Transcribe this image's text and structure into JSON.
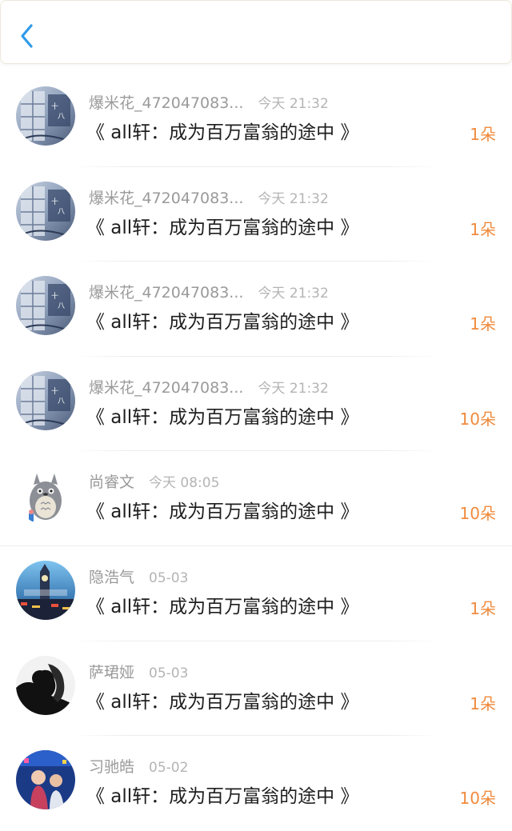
{
  "header": {
    "back_icon": "chevron-left-icon",
    "accent_color": "#2f9be8"
  },
  "colors": {
    "count": "#f08a3c",
    "name": "#9a9a9a",
    "time": "#b4b4b4",
    "title": "#1e1e1e"
  },
  "items": [
    {
      "name": "爆米花_472047083...",
      "time": "今天 21:32",
      "title": "《 all轩：成为百万富翁的途中 》",
      "count": "1朵",
      "avatar": "window-sketch-avatar"
    },
    {
      "name": "爆米花_472047083...",
      "time": "今天 21:32",
      "title": "《 all轩：成为百万富翁的途中 》",
      "count": "1朵",
      "avatar": "window-sketch-avatar"
    },
    {
      "name": "爆米花_472047083...",
      "time": "今天 21:32",
      "title": "《 all轩：成为百万富翁的途中 》",
      "count": "1朵",
      "avatar": "window-sketch-avatar"
    },
    {
      "name": "爆米花_472047083...",
      "time": "今天 21:32",
      "title": "《 all轩：成为百万富翁的途中 》",
      "count": "10朵",
      "avatar": "window-sketch-avatar"
    },
    {
      "name": "尚睿文",
      "time": "今天 08:05",
      "title": "《 all轩：成为百万富翁的途中 》",
      "count": "10朵",
      "avatar": "totoro-avatar"
    },
    {
      "name": "隐浩气",
      "time": "05-03",
      "title": "《 all轩：成为百万富翁的途中 》",
      "count": "1朵",
      "avatar": "big-ben-avatar"
    },
    {
      "name": "萨珺娅",
      "time": "05-03",
      "title": "《 all轩：成为百万富翁的途中 》",
      "count": "1朵",
      "avatar": "silhouette-avatar"
    },
    {
      "name": "习驰皓",
      "time": "05-02",
      "title": "《 all轩：成为百万富翁的途中 》",
      "count": "10朵",
      "avatar": "concert-avatar"
    }
  ]
}
